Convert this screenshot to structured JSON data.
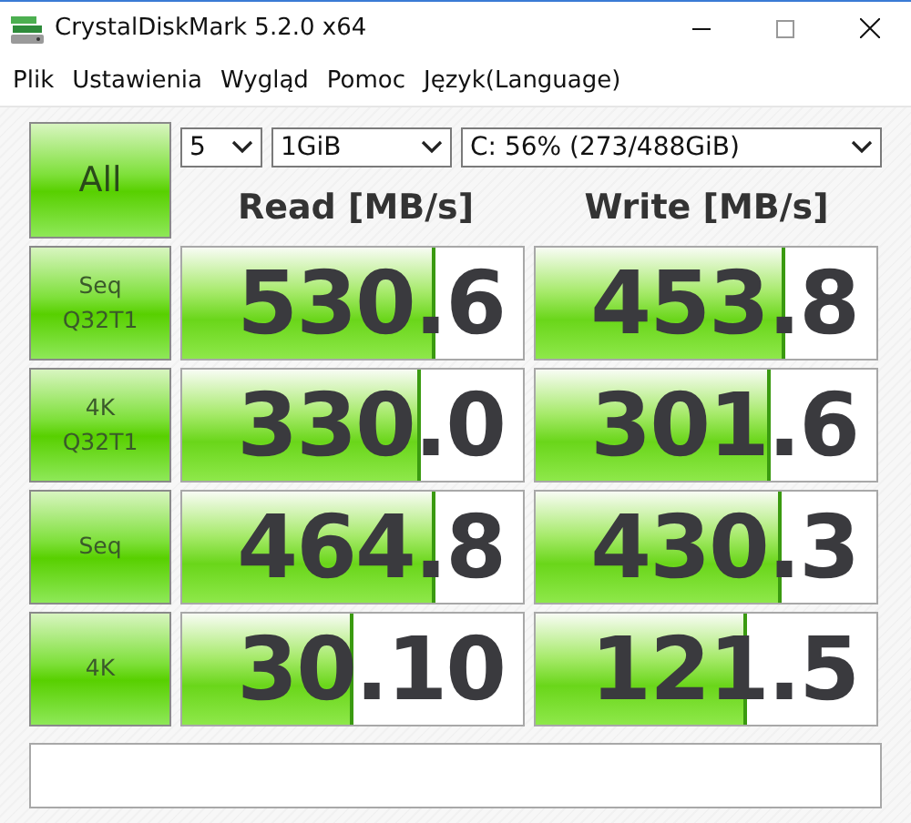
{
  "window": {
    "title": "CrystalDiskMark 5.2.0 x64"
  },
  "menu": [
    "Plik",
    "Ustawienia",
    "Wygląd",
    "Pomoc",
    "Język(Language)"
  ],
  "controls": {
    "all_button": "All",
    "count": "5",
    "size": "1GiB",
    "drive": "C: 56% (273/488GiB)"
  },
  "headers": [
    "Read [MB/s]",
    "Write [MB/s]"
  ],
  "tests": [
    {
      "label": "Seq\nQ32T1",
      "read": {
        "value": "530.6",
        "level": 0.735
      },
      "write": {
        "value": "453.8",
        "level": 0.72
      }
    },
    {
      "label": "4K\nQ32T1",
      "read": {
        "value": "330.0",
        "level": 0.69
      },
      "write": {
        "value": "301.6",
        "level": 0.68
      }
    },
    {
      "label": "Seq",
      "read": {
        "value": "464.8",
        "level": 0.73
      },
      "write": {
        "value": "430.3",
        "level": 0.71
      }
    },
    {
      "label": "4K",
      "read": {
        "value": "30.10",
        "level": 0.49
      },
      "write": {
        "value": "121.5",
        "level": 0.61
      }
    }
  ]
}
